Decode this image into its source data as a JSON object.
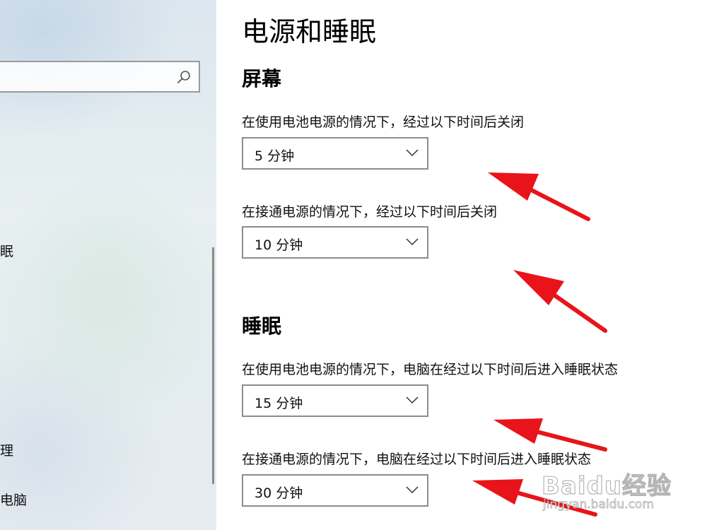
{
  "nav": {
    "search": {
      "placeholder": "",
      "value": ""
    },
    "items": [
      {
        "label": "眠"
      },
      {
        "label": "理"
      },
      {
        "label": "电脑"
      }
    ]
  },
  "page": {
    "title": "电源和睡眠"
  },
  "screen": {
    "heading": "屏幕",
    "battery_label": "在使用电池电源的情况下，经过以下时间后关闭",
    "battery_value": "5 分钟",
    "plugged_label": "在接通电源的情况下，经过以下时间后关闭",
    "plugged_value": "10 分钟"
  },
  "sleep": {
    "heading": "睡眠",
    "battery_label": "在使用电池电源的情况下，电脑在经过以下时间后进入睡眠状态",
    "battery_value": "15 分钟",
    "plugged_label": "在接通电源的情况下，电脑在经过以下时间后进入睡眠状态",
    "plugged_value": "30 分钟"
  },
  "watermark": {
    "brand": "Baidu经验",
    "url": "jingyan.baidu.com"
  },
  "colors": {
    "annotation_arrow": "#e8141a",
    "dropdown_border": "#8c8c8c"
  }
}
